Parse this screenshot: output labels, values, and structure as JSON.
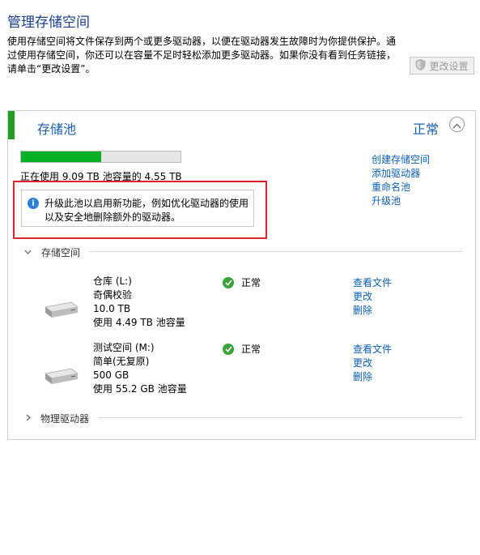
{
  "header": {
    "title": "管理存储空间",
    "description_lines": [
      "使用存储空间将文件保存到两个或更多驱动器，以便在驱动器发生故障时为你提供保护。通",
      "过使用存储空间，你还可以在容量不足时轻松添加更多驱动器。如果你没有看到任务链接，",
      "请单击“更改设置”。"
    ],
    "change_settings_label": "更改设置"
  },
  "pool": {
    "title": "存储池",
    "status": "正常",
    "usage_fraction": 0.5,
    "usage_text": "正在使用 9.09 TB 池容量的 4.55 TB",
    "info_lines": [
      "升级此池以启用新功能，例如优化驱动器的使用",
      "以及安全地删除额外的驱动器。"
    ],
    "actions": [
      "创建存储空间",
      "添加驱动器",
      "重命名池",
      "升级池"
    ],
    "spaces_header": "存储空间",
    "physical_header": "物理驱动器",
    "spaces": [
      {
        "name": "仓库 (L:)",
        "resiliency": "奇偶校验",
        "size": "10.0 TB",
        "used": "使用 4.49 TB 池容量",
        "status": "正常",
        "actions": [
          "查看文件",
          "更改",
          "删除"
        ]
      },
      {
        "name": "测试空间 (M:)",
        "resiliency": "简单(无复原)",
        "size": "500 GB",
        "used": "使用 55.2 GB 池容量",
        "status": "正常",
        "actions": [
          "查看文件",
          "更改",
          "删除"
        ]
      }
    ]
  },
  "colors": {
    "accent_green": "#1f9e1f",
    "usage_fill": "#06b025",
    "link_blue": "#0b5fb3",
    "title_blue": "#1a3f8f",
    "highlight_red": "#e0262b"
  }
}
